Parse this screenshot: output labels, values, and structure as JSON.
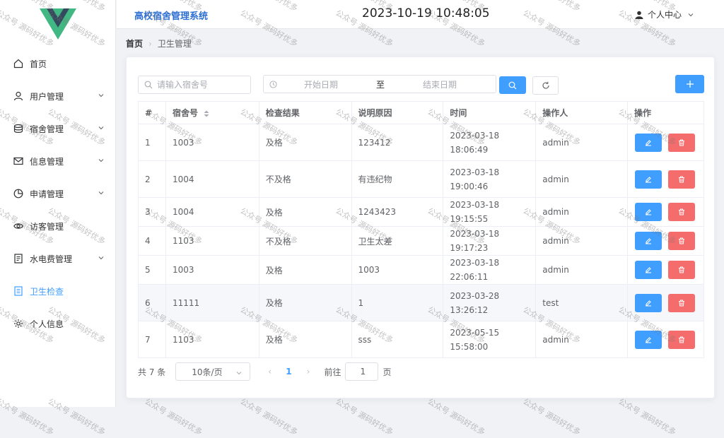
{
  "header": {
    "app_title": "高校宿舍管理系统",
    "clock": "2023-10-19 10:48:05",
    "user_menu_label": "个人中心"
  },
  "sidebar": {
    "items": [
      {
        "label": "首页",
        "icon": "home-icon",
        "has_arrow": false
      },
      {
        "label": "用户管理",
        "icon": "user-icon",
        "has_arrow": true
      },
      {
        "label": "宿舍管理",
        "icon": "database-icon",
        "has_arrow": true
      },
      {
        "label": "信息管理",
        "icon": "mail-icon",
        "has_arrow": true
      },
      {
        "label": "申请管理",
        "icon": "pie-chart-icon",
        "has_arrow": true
      },
      {
        "label": "访客管理",
        "icon": "eye-icon",
        "has_arrow": false
      },
      {
        "label": "水电费管理",
        "icon": "bill-icon",
        "has_arrow": true
      },
      {
        "label": "卫生检查",
        "icon": "document-icon",
        "has_arrow": false,
        "active": true
      },
      {
        "label": "个人信息",
        "icon": "gear-icon",
        "has_arrow": false
      }
    ]
  },
  "breadcrumb": {
    "home": "首页",
    "current": "卫生管理"
  },
  "search": {
    "dorm_placeholder": "请输入宿舍号",
    "start_placeholder": "开始日期",
    "range_separator": "至",
    "end_placeholder": "结束日期"
  },
  "table": {
    "columns": [
      "#",
      "宿舍号",
      "检查结果",
      "说明原因",
      "时间",
      "操作人",
      "操作"
    ],
    "rows": [
      {
        "index": "1",
        "dorm": "1003",
        "result": "及格",
        "reason": "123412",
        "time": "2023-03-18 18:06:49",
        "operator": "admin"
      },
      {
        "index": "2",
        "dorm": "1004",
        "result": "不及格",
        "reason": "有违纪物",
        "time": "2023-03-18 19:00:46",
        "operator": "admin"
      },
      {
        "index": "3",
        "dorm": "1004",
        "result": "及格",
        "reason": "1243423",
        "time": "2023-03-18 19:15:55",
        "operator": "admin"
      },
      {
        "index": "4",
        "dorm": "1103",
        "result": "不及格",
        "reason": "卫生太差",
        "time": "2023-03-18 19:17:23",
        "operator": "admin"
      },
      {
        "index": "5",
        "dorm": "1003",
        "result": "及格",
        "reason": "1003",
        "time": "2023-03-18 22:06:11",
        "operator": "admin"
      },
      {
        "index": "6",
        "dorm": "11111",
        "result": "及格",
        "reason": "1",
        "time": "2023-03-28 13:26:12",
        "operator": "test"
      },
      {
        "index": "7",
        "dorm": "1103",
        "result": "及格",
        "reason": "sss",
        "time": "2023-05-15 15:58:00",
        "operator": "admin"
      }
    ]
  },
  "pagination": {
    "total": "共 7 条",
    "page_size": "10条/页",
    "current_page": "1",
    "goto_label": "前往",
    "goto_value": "1",
    "page_suffix": "页"
  },
  "watermark_text": "公众号 源码好优多",
  "colors": {
    "primary": "#409eff",
    "danger": "#f56c6c",
    "title": "#2d6fd2"
  }
}
